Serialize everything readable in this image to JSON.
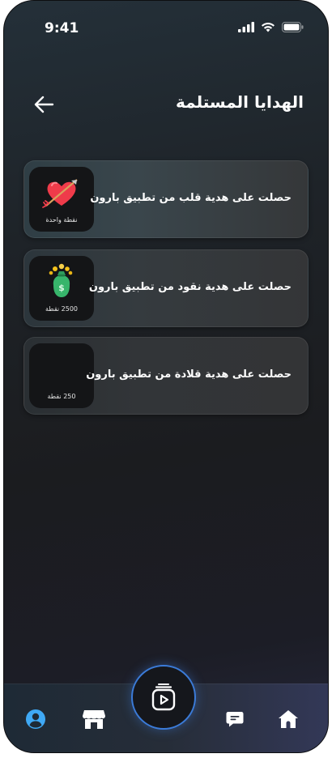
{
  "status_bar": {
    "time": "9:41"
  },
  "header": {
    "title": "الهدايا المستلمة",
    "back_icon": "arrow-left-icon"
  },
  "gifts": [
    {
      "text": "حصلت على هدية قلب من تطبيق بارون",
      "points": "نقطة واحدة",
      "icon": "heart-arrow-icon"
    },
    {
      "text": "حصلت على هدية نقود من تطبيق بارون",
      "points": "2500 نقطة",
      "icon": "money-bag-icon"
    },
    {
      "text": "حصلت على هدية قلادة من تطبيق بارون",
      "points": "250 نقطة",
      "icon": ""
    }
  ],
  "bottom_nav": {
    "items": [
      "profile-icon",
      "store-icon",
      "chat-icon",
      "home-icon"
    ],
    "center": "reels-icon",
    "active_color": "#3fa9f5",
    "accent": "#3b7bd8"
  }
}
